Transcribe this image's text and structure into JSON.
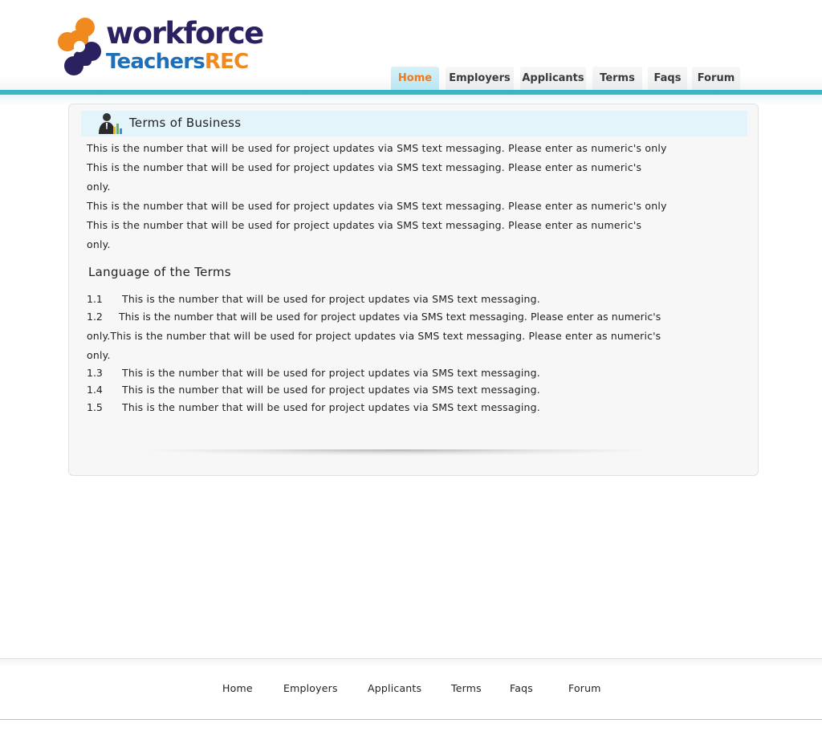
{
  "brand": {
    "word1": "workforce",
    "word2a": "Teachers",
    "word2b": "REC",
    "colors": {
      "navy": "#2a2161",
      "blue": "#1e6fb8",
      "orange": "#f18a1e",
      "accent_bar": "#3bb4c8"
    }
  },
  "nav": [
    {
      "label": "Home",
      "active": true
    },
    {
      "label": "Employers"
    },
    {
      "label": "Applicants"
    },
    {
      "label": "Terms"
    },
    {
      "label": "Faqs"
    },
    {
      "label": "Forum"
    }
  ],
  "content": {
    "title": "Terms of Business",
    "title_icon": "businessman-chart-icon",
    "paragraphs": [
      "This is the number that will be used for project updates via SMS text messaging. Please enter as numeric's only",
      "This is the number that will be used for project updates via SMS text messaging. Please enter as numeric's",
      "only.",
      "This is the number that will be used for project updates via SMS text messaging. Please enter as numeric's only",
      "This is the number that will be used for project updates via SMS text messaging. Please enter as numeric's",
      "only."
    ],
    "subheading": "Language of the Terms",
    "clauses": [
      {
        "num": "1.1",
        "text": "This is the number that will be used for project updates via SMS text messaging."
      },
      {
        "num": "1.2",
        "text": "This is the number that will be used for project updates via SMS text messaging. Please enter as numeric's"
      },
      {
        "num": "",
        "text": "only.This is the number that will be used for project updates via SMS text messaging. Please enter as numeric's"
      },
      {
        "num": "",
        "text": "only."
      },
      {
        "num": "1.3",
        "text": "This is the number that will be used for project updates via SMS text messaging."
      },
      {
        "num": "1.4",
        "text": "This is the number that will be used for project updates via SMS text messaging."
      },
      {
        "num": "1.5",
        "text": "This is the number that will be used for project updates via SMS text messaging."
      }
    ]
  },
  "footer": {
    "links": [
      "Home",
      "Employers",
      "Applicants",
      "Terms",
      "Faqs",
      "Forum"
    ]
  }
}
